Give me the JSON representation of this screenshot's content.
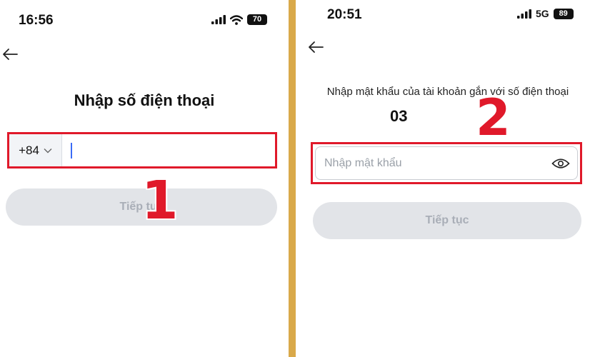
{
  "left_screen": {
    "status": {
      "time": "16:56",
      "battery": "70"
    },
    "title": "Nhập số điện thoại",
    "country_code": "+84",
    "continue_label": "Tiếp tục",
    "step_marker": "1"
  },
  "right_screen": {
    "status": {
      "time": "20:51",
      "network": "5G",
      "battery": "89"
    },
    "prompt": "Nhập mật khẩu của tài khoản gắn với số điện thoại",
    "phone_number": "03",
    "password_placeholder": "Nhập mật khẩu",
    "continue_label": "Tiếp tục",
    "step_marker": "2"
  },
  "colors": {
    "highlight_red": "#e0192a",
    "divider": "#d9a94a",
    "caret_blue": "#3b6cf6",
    "disabled_button_bg": "#e2e4e8",
    "disabled_button_text": "#a9aeb7"
  },
  "icons": [
    "back-arrow-icon",
    "signal-icon",
    "wifi-icon",
    "battery-icon",
    "chevron-down-icon",
    "eye-icon"
  ]
}
